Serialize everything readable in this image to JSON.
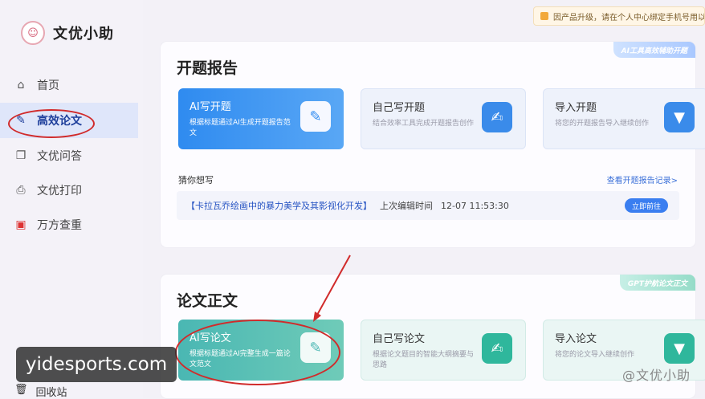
{
  "app": {
    "logo_text": "文优小助",
    "logo_icon": "mascot-icon"
  },
  "notice": {
    "text": "因产品升级，请在个人中心绑定手机号用以登"
  },
  "sidebar": {
    "items": [
      {
        "label": "首页",
        "icon": "home-icon"
      },
      {
        "label": "高效论文",
        "icon": "pen-icon"
      },
      {
        "label": "文优问答",
        "icon": "chat-icon"
      },
      {
        "label": "文优打印",
        "icon": "printer-icon"
      },
      {
        "label": "万方查重",
        "icon": "check-icon"
      }
    ],
    "trash_label": "回收站"
  },
  "panel_proposal": {
    "title": "开题报告",
    "tag": "AI工具高效辅助开题",
    "tiles": [
      {
        "title": "AI写开题",
        "desc": "根据标题通过AI生成开题报告范文"
      },
      {
        "title": "自己写开题",
        "desc": "结合效率工具完成开题报告创作"
      },
      {
        "title": "导入开题",
        "desc": "将您的开题报告导入继续创作"
      }
    ],
    "guess_label": "猜你想写",
    "history_link": "查看开题报告记录>",
    "recent": {
      "title": "【卡拉瓦乔绘画中的暴力美学及其影视化开发】",
      "meta_label": "上次编辑时间",
      "time": "12-07 11:53:30",
      "button": "立即前往"
    }
  },
  "panel_paper": {
    "title": "论文正文",
    "tag": "GPT护航论文正文",
    "tiles": [
      {
        "title": "AI写论文",
        "desc": "根据标题通过AI完整生成一篇论文范文"
      },
      {
        "title": "自己写论文",
        "desc": "根据论文题目的智能大纲摘要与思路"
      },
      {
        "title": "导入论文",
        "desc": "将您的论文导入继续创作"
      }
    ]
  },
  "watermark": {
    "site": "yidesports.com",
    "corner": "@文优小助"
  },
  "colors": {
    "accent_blue": "#2f8bf0",
    "accent_green": "#4ab7b3",
    "annotation_red": "#d12b2b"
  }
}
